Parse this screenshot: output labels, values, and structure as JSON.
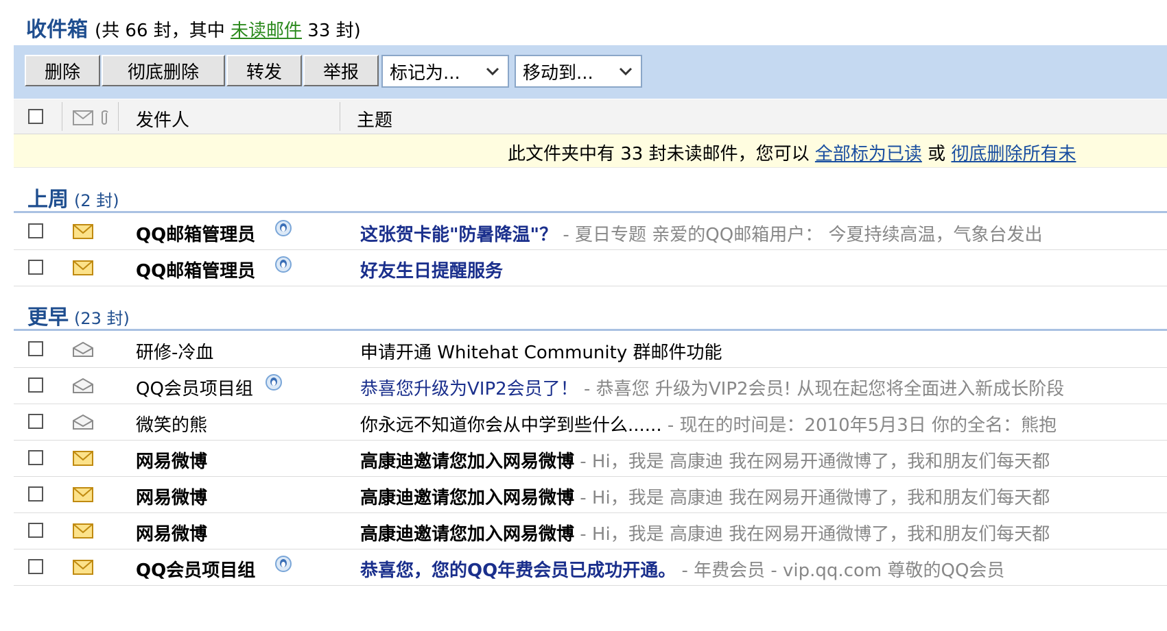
{
  "header": {
    "title": "收件箱",
    "prefix": "(共 66 封，其中 ",
    "unread_link": "未读邮件",
    "suffix": " 33 封)"
  },
  "toolbar": {
    "delete": "删除",
    "purge": "彻底删除",
    "forward": "转发",
    "report": "举报",
    "mark_as": "标记为...",
    "move_to": "移动到..."
  },
  "columns": {
    "sender": "发件人",
    "subject": "主题"
  },
  "notice": {
    "text": "此文件夹中有 33 封未读邮件，您可以 ",
    "mark_all_read": "全部标为已读",
    "or": " 或 ",
    "delete_all": "彻底删除所有未"
  },
  "groups": {
    "last_week": {
      "name": "上周",
      "count": "(2 封)"
    },
    "earlier": {
      "name": "更早",
      "count": "(23 封)"
    }
  },
  "rows": [
    {
      "sender": "QQ邮箱管理员",
      "subject": "这张贺卡能\"防暑降温\"？",
      "preview": " - 夏日专题 亲爱的QQ邮箱用户： 今夏持续高温，气象台发出",
      "unread": true,
      "qq_icon": true
    },
    {
      "sender": "QQ邮箱管理员",
      "subject": "好友生日提醒服务",
      "preview": "",
      "unread": true,
      "qq_icon": true
    },
    {
      "sender": "研修-冷血",
      "subject": "申请开通 Whitehat Community 群邮件功能",
      "preview": "",
      "unread": false,
      "qq_icon": false
    },
    {
      "sender": "QQ会员项目组",
      "subject": "恭喜您升级为VIP2会员了！",
      "preview": " - 恭喜您 升级为VIP2会员! 从现在起您将全面进入新成长阶段",
      "unread": false,
      "qq_icon": true
    },
    {
      "sender": "微笑的熊",
      "subject": "你永远不知道你会从中学到些什么......",
      "preview": " -  现在的时间是：2010年5月3日  你的全名：熊抱",
      "unread": false,
      "qq_icon": false
    },
    {
      "sender": "网易微博",
      "subject": "高康迪邀请您加入网易微博",
      "preview": " - Hi，我是 高康迪  我在网易开通微博了，我和朋友们每天都",
      "unread": true,
      "qq_icon": false
    },
    {
      "sender": "网易微博",
      "subject": "高康迪邀请您加入网易微博",
      "preview": " - Hi，我是 高康迪  我在网易开通微博了，我和朋友们每天都",
      "unread": true,
      "qq_icon": false
    },
    {
      "sender": "网易微博",
      "subject": "高康迪邀请您加入网易微博",
      "preview": " - Hi，我是 高康迪  我在网易开通微博了，我和朋友们每天都",
      "unread": true,
      "qq_icon": false
    },
    {
      "sender": "QQ会员项目组",
      "subject": "恭喜您，您的QQ年费会员已成功开通。",
      "preview": " -  年费会员 - vip.qq.com  尊敬的QQ会员",
      "unread": true,
      "qq_icon": true
    }
  ],
  "colors": {
    "toolbar_bg": "#c5d9f1",
    "title_blue": "#1f4e8f",
    "subject_blue": "#1a2f8c",
    "unread_link_green": "#2c8a1e",
    "notice_bg": "#fffde0"
  },
  "icons": {
    "unread_mail": "envelope-closed-icon",
    "read_mail": "envelope-open-icon",
    "qq": "qq-penguin-icon",
    "attachment": "paperclip-icon"
  }
}
